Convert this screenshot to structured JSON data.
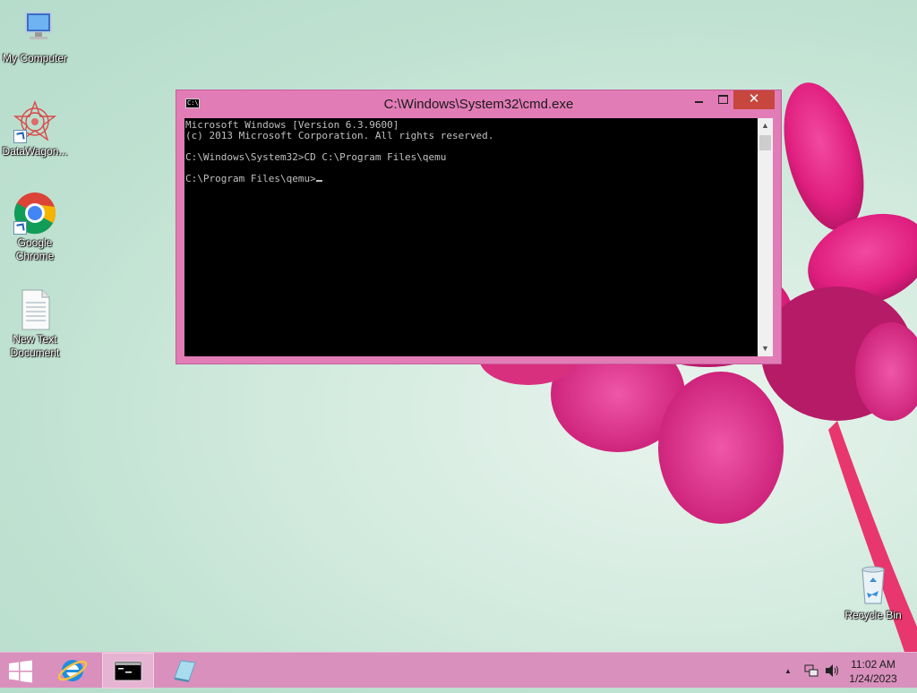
{
  "desktop": {
    "icons": [
      {
        "label": "My Computer",
        "icon": "computer-icon"
      },
      {
        "label": "DataWagon...",
        "icon": "datawagon-icon"
      },
      {
        "label": "Google Chrome",
        "icon": "chrome-icon"
      },
      {
        "label": "New Text Document",
        "icon": "text-document-icon"
      },
      {
        "label": "Recycle Bin",
        "icon": "recycle-bin-icon"
      }
    ]
  },
  "window": {
    "title": "C:\\Windows\\System32\\cmd.exe",
    "title_icon_text": "C:\\",
    "close_glyph": "✕",
    "scroll_up_glyph": "▲",
    "scroll_down_glyph": "▼",
    "console_lines": [
      "Microsoft Windows [Version 6.3.9600]",
      "(c) 2013 Microsoft Corporation. All rights reserved.",
      "",
      "C:\\Windows\\System32>CD C:\\Program Files\\qemu",
      "",
      "C:\\Program Files\\qemu>"
    ]
  },
  "taskbar": {
    "buttons": [
      {
        "name": "start",
        "icon": "windows-logo-icon"
      },
      {
        "name": "internet-explorer",
        "icon": "ie-icon"
      },
      {
        "name": "command-prompt",
        "icon": "cmd-icon",
        "active": true
      },
      {
        "name": "notepad",
        "icon": "notepad-icon"
      }
    ],
    "tray": {
      "show_hidden_glyph": "▲",
      "network_icon": "network-icon",
      "volume_icon": "volume-icon"
    },
    "clock": {
      "time": "11:02 AM",
      "date": "1/24/2023"
    }
  },
  "colors": {
    "titlebar": "#e27cb7",
    "close_button": "#c7463d",
    "console_bg": "#000000",
    "console_fg": "#c0c0c0",
    "taskbar": "#d990bd"
  }
}
